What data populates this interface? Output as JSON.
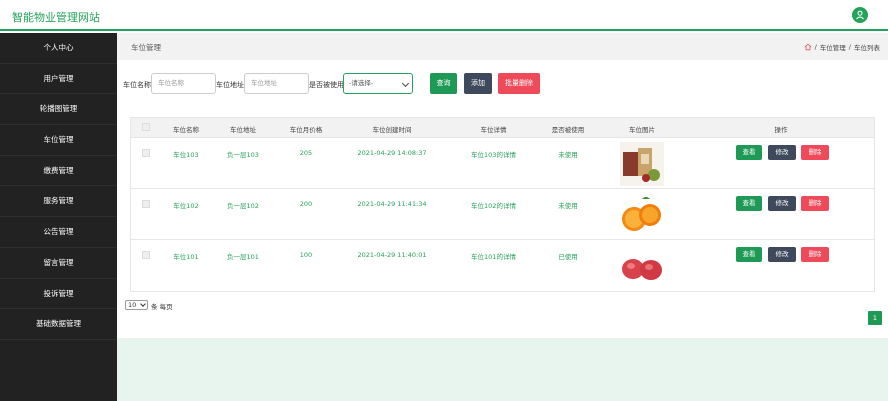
{
  "app": {
    "title": "智能物业管理网站"
  },
  "sidebar": {
    "items": [
      {
        "label": "个人中心"
      },
      {
        "label": "用户管理"
      },
      {
        "label": "轮播图管理"
      },
      {
        "label": "车位管理"
      },
      {
        "label": "缴费管理"
      },
      {
        "label": "服务管理"
      },
      {
        "label": "公告管理"
      },
      {
        "label": "留言管理"
      },
      {
        "label": "投诉管理"
      },
      {
        "label": "基础数据管理"
      }
    ]
  },
  "header": {
    "title": "车位管理",
    "breadcrumb": {
      "level1": "车位管理",
      "sep": "/",
      "level2": "车位列表"
    }
  },
  "search": {
    "name_label": "车位名称",
    "name_placeholder": "车位名称",
    "address_label": "车位地址",
    "address_placeholder": "车位地址",
    "used_label": "是否被使用",
    "used_select_value": "-请选择-",
    "query_label": "查询",
    "add_label": "添加",
    "batch_delete_label": "批量删除"
  },
  "table": {
    "headers": [
      "车位名称",
      "车位地址",
      "车位月价格",
      "车位创建时间",
      "车位详情",
      "是否被使用",
      "车位图片",
      "操作"
    ],
    "rows": [
      {
        "name": "车位103",
        "address": "负一层103",
        "price": "205",
        "created": "2021-04-29 14:08:37",
        "detail": "车位103的详情",
        "used": "未使用",
        "image": "gift-box"
      },
      {
        "name": "车位102",
        "address": "负一层102",
        "price": "200",
        "created": "2021-04-29 11:41:34",
        "detail": "车位102的详情",
        "used": "未使用",
        "image": "oranges"
      },
      {
        "name": "车位101",
        "address": "负一层101",
        "price": "100",
        "created": "2021-04-29 11:40:01",
        "detail": "车位101的详情",
        "used": "已使用",
        "image": "apples"
      }
    ],
    "actions": {
      "view": "查看",
      "edit": "修改",
      "delete": "删除"
    }
  },
  "pagination": {
    "page_size": "10",
    "per_page_label": "条 每页",
    "current_page": "1"
  },
  "colors": {
    "accent": "#25a25a",
    "sidebar_bg": "#222222",
    "danger": "#ef4a5a",
    "dark_button": "#3e4a5c"
  }
}
